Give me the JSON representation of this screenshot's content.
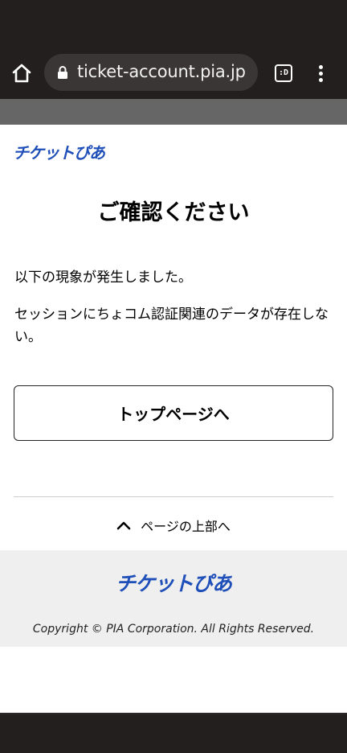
{
  "browser": {
    "url": "ticket-account.pia.jp",
    "tab_label": ":D"
  },
  "header": {
    "logo": "チケットぴあ"
  },
  "main": {
    "title": "ご確認ください",
    "message_line1": "以下の現象が発生しました。",
    "message_line2": "セッションにちょコム認証関連のデータが存在しない。",
    "top_button_label": "トップページへ",
    "back_to_top_label": "ページの上部へ"
  },
  "footer": {
    "logo": "チケットぴあ",
    "copyright": "Copyright © PIA Corporation. All Rights Reserved."
  },
  "colors": {
    "brand": "#1f4fb8",
    "browser_chrome": "#231f1f",
    "footer_bg": "#efefef"
  }
}
